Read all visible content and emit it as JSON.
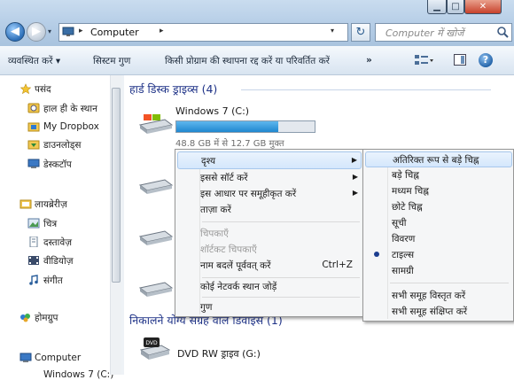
{
  "window": {
    "controls": {
      "minimize": "▁",
      "maximize": "□",
      "close": "✕"
    }
  },
  "nav": {
    "back_glyph": "◀",
    "forward_glyph": "▶",
    "history_glyph": "▾"
  },
  "address": {
    "separator": "▸",
    "location": "Computer",
    "dropdown_glyph": "▾"
  },
  "refresh_glyph": "↻",
  "search": {
    "placeholder": "Computer में खोजें"
  },
  "toolbar": {
    "organize": "व्यवस्थित करें ▾",
    "system_properties": "सिस्टम गुण",
    "uninstall": "किसी प्रोग्राम की स्थापना रद्द करें या परिवर्तित करें",
    "more": "»",
    "help": "?"
  },
  "sidebar": {
    "favorites": {
      "label": "पसंद",
      "items": [
        {
          "label": "हाल ही के स्थान",
          "icon": "recent-places-icon"
        },
        {
          "label": "My Dropbox",
          "icon": "dropbox-folder-icon"
        },
        {
          "label": "डाउनलोड्स",
          "icon": "downloads-folder-icon"
        },
        {
          "label": "डेस्कटॉप",
          "icon": "desktop-icon"
        }
      ]
    },
    "libraries": {
      "label": "लायब्रेरीज़",
      "items": [
        {
          "label": "चित्र",
          "icon": "pictures-icon"
        },
        {
          "label": "दस्तावेज़",
          "icon": "documents-icon"
        },
        {
          "label": "वीडियोज़",
          "icon": "videos-icon"
        },
        {
          "label": "संगीत",
          "icon": "music-icon"
        }
      ]
    },
    "homegroup": "होमग्रुप",
    "computer": "Computer",
    "partial": "Windows 7 (C:)"
  },
  "content": {
    "hdd_group": "हार्ड डिस्क ड्राइव्स (4)",
    "drive_c": {
      "name": "Windows 7  (C:)",
      "free_text": "48.8 GB में से 12.7 GB मुक्त",
      "used_fraction": 0.74
    },
    "removable_group": "निकालने योग्य संग्रह वाले डिवाइस (1)",
    "dvd": {
      "name": "DVD RW ड्राइव (G:)",
      "badge": "DVD"
    }
  },
  "context_menu": {
    "view": "दृश्य",
    "sort_by": "इससे सॉर्ट करें",
    "group_by": "इस आधार पर समूहीकृत करें",
    "refresh": "ताज़ा करें",
    "paste": "चिपकाएँ",
    "paste_shortcut": "शॉर्टकट चिपकाएँ",
    "undo_rename": "नाम बदलें पूर्ववत् करें",
    "undo_shortcut": "Ctrl+Z",
    "add_network_location": "कोई नेटवर्क स्थान जोड़ें",
    "properties": "गुण",
    "arrow": "▶"
  },
  "view_submenu": {
    "items": [
      "अतिरिक्त रूप से बड़े चिह्न",
      "बड़े चिह्न",
      "मध्यम चिह्न",
      "छोटे चिह्न",
      "सूची",
      "विवरण",
      "टाइल्स",
      "सामग्री"
    ],
    "expand_all": "सभी समूह विस्तृत करें",
    "collapse_all": "सभी समूह संक्षिप्त करें"
  }
}
